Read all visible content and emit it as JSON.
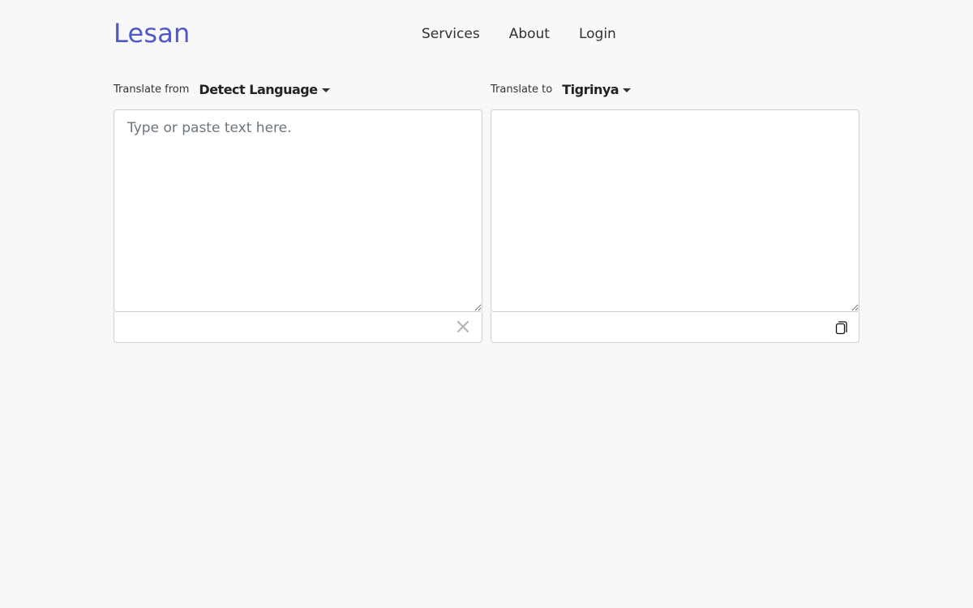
{
  "header": {
    "logo": "Lesan",
    "nav": [
      "Services",
      "About",
      "Login"
    ]
  },
  "source": {
    "caption": "Translate from",
    "language": "Detect Language",
    "placeholder": "Type or paste text here.",
    "value": ""
  },
  "target": {
    "caption": "Translate to",
    "language": "Tigrinya",
    "value": ""
  },
  "icons": {
    "clear": "close-icon",
    "copy": "copy-icon",
    "caret": "caret-down-icon"
  },
  "colors": {
    "brand": "#5057c8",
    "background": "#f8f8f8"
  }
}
